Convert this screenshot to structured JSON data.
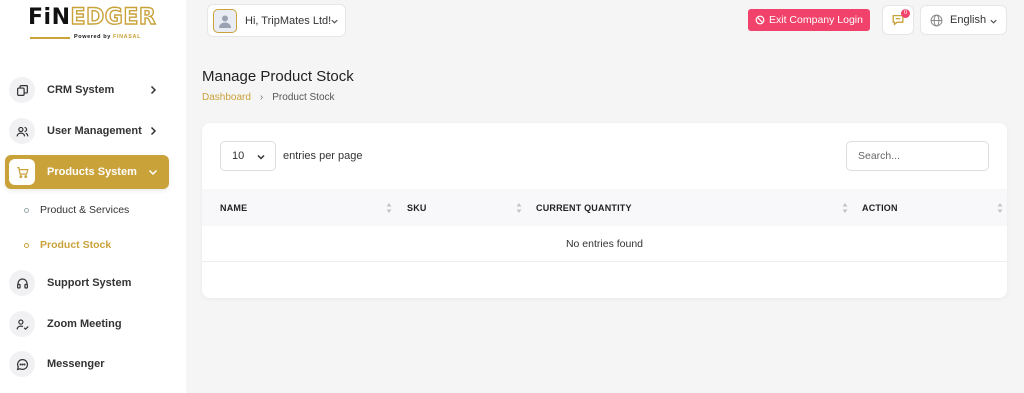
{
  "brand": {
    "logo_part1": "FiN",
    "logo_part2": "EDGER",
    "tagline_prefix": "Powered by",
    "tagline_brand": "FINASAL"
  },
  "sidebar": {
    "items": [
      {
        "label": "CRM System",
        "icon": "crm-icon"
      },
      {
        "label": "User Management",
        "icon": "users-icon"
      },
      {
        "label": "Products System",
        "icon": "cart-icon",
        "active": true
      },
      {
        "label": "Support System",
        "icon": "headset-icon"
      },
      {
        "label": "Zoom Meeting",
        "icon": "user-check-icon"
      },
      {
        "label": "Messenger",
        "icon": "message-icon"
      }
    ],
    "subitems": [
      {
        "label": "Product & Services"
      },
      {
        "label": "Product Stock",
        "active": true
      }
    ]
  },
  "header": {
    "greeting": "Hi, TripMates Ltd!",
    "exit_label": "Exit Company Login",
    "notification_count": "0",
    "language": "English"
  },
  "page": {
    "title": "Manage Product Stock",
    "breadcrumb": [
      "Dashboard",
      "Product Stock"
    ]
  },
  "table": {
    "per_page_value": "10",
    "per_page_label": "entries per page",
    "search_placeholder": "Search...",
    "columns": [
      "NAME",
      "SKU",
      "CURRENT QUANTITY",
      "ACTION"
    ],
    "empty_message": "No entries found"
  },
  "colors": {
    "accent": "#c9a23a",
    "danger": "#f0426a"
  }
}
